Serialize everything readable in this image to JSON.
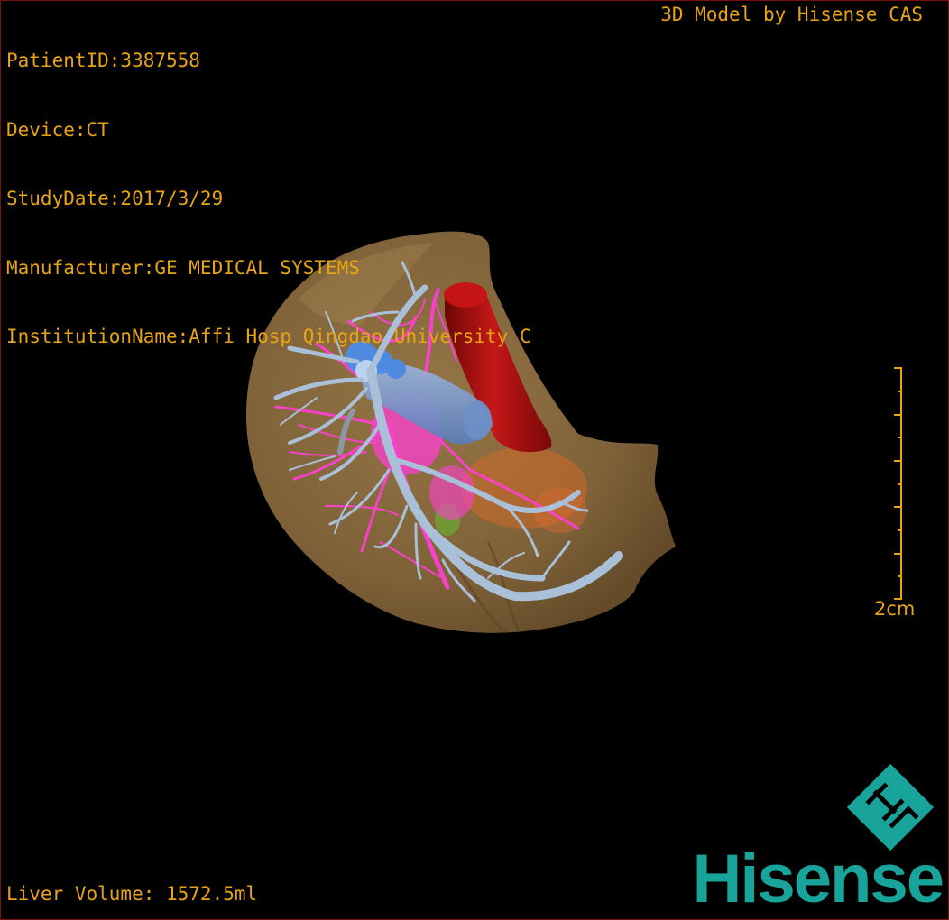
{
  "dicom_info": {
    "patient_id": "PatientID:3387558",
    "device": "Device:CT",
    "study_date": "StudyDate:2017/3/29",
    "manufacturer": "Manufacturer:GE MEDICAL SYSTEMS",
    "institution": "InstitutionName:Affi Hosp Qingdao University C"
  },
  "credit": "3D Model by Hisense CAS",
  "scale_label": "2cm",
  "liver_volume": "Liver Volume: 1572.5ml",
  "brand": {
    "name": "Hisense",
    "color": "#18a49a"
  },
  "colors": {
    "overlay_text": "#e8a412",
    "liver": "#8a6c3e",
    "portal_vein": "#a9c0d8",
    "hepatic_artery": "#ff3fd2",
    "ivc": "#a80e0e",
    "vein_trunk": "#5a8fd0",
    "border": "#7a1010"
  }
}
